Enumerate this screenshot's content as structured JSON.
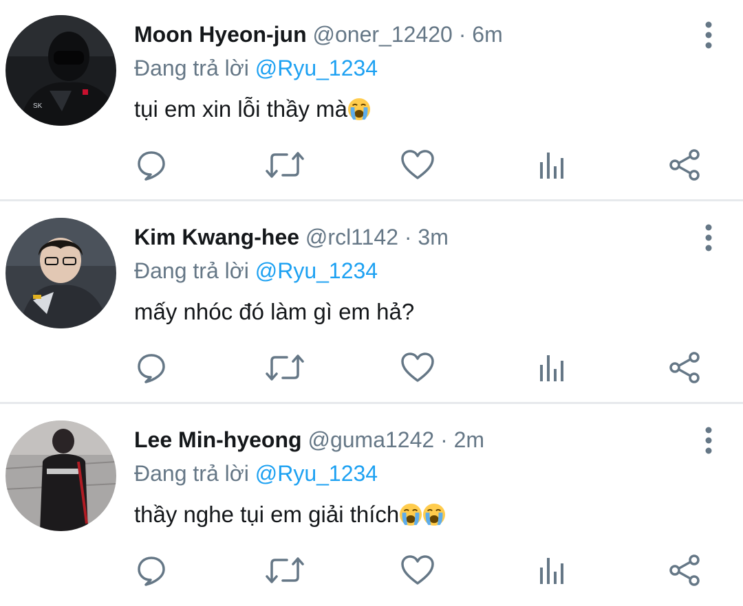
{
  "colors": {
    "name": "#14171a",
    "muted": "#657786",
    "mention": "#1da1f2",
    "icon": "#657786",
    "divider": "#e6e9ec"
  },
  "icons": {
    "reply": "comment-bubble-icon",
    "retweet": "retweet-icon",
    "like": "heart-icon",
    "stats": "bar-chart-icon",
    "share": "share-icon",
    "more": "vertical-dots-icon",
    "emoji": "loudly-crying-face-emoji"
  },
  "tweets": [
    {
      "name": "Moon Hyeon-jun",
      "handle": "@oner_12420",
      "separator": "·",
      "time": "6m",
      "reply_prefix": "Đang trả lời",
      "reply_to": "@Ryu_1234",
      "text": "tụi em xin lỗi thầy mà",
      "emoji_count": 1
    },
    {
      "name": "Kim Kwang-hee",
      "handle": "@rcl1142",
      "separator": "·",
      "time": "3m",
      "reply_prefix": "Đang trả lời",
      "reply_to": "@Ryu_1234",
      "text": "mấy nhóc đó làm gì em hả?",
      "emoji_count": 0
    },
    {
      "name": "Lee Min-hyeong",
      "handle": "@guma1242",
      "separator": "·",
      "time": "2m",
      "reply_prefix": "Đang trả lời",
      "reply_to": "@Ryu_1234",
      "text": "thầy nghe tụi em giải thích",
      "emoji_count": 2
    }
  ]
}
